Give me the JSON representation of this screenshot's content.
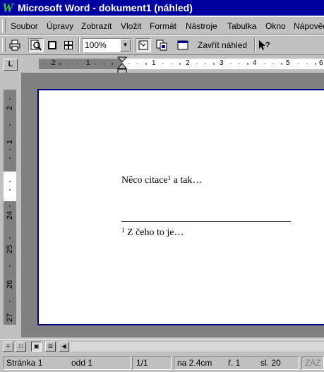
{
  "window": {
    "title": "Microsoft Word - dokument1 (náhled)",
    "logo": "W"
  },
  "menu": {
    "items": [
      {
        "label": "Soubor"
      },
      {
        "label": "Úpravy"
      },
      {
        "label": "Zobrazit"
      },
      {
        "label": "Vložit"
      },
      {
        "label": "Formát"
      },
      {
        "label": "Nástroje"
      },
      {
        "label": "Tabulka"
      },
      {
        "label": "Okno"
      },
      {
        "label": "Nápověda"
      }
    ]
  },
  "toolbar": {
    "icons": [
      "print-icon",
      "magnifier-icon",
      "one-page-icon",
      "multiple-pages-icon",
      "full-screen-icon",
      "shrink-to-fit-icon",
      "help-icon"
    ],
    "zoom_value": "100%",
    "close_preview_label": "Zavřít náhled"
  },
  "ruler": {
    "corner_label": "L",
    "h_labels": [
      "2",
      "1",
      "1",
      "2",
      "3",
      "4",
      "5",
      "6"
    ],
    "v_labels": [
      "2",
      "1",
      "24",
      "25",
      "26",
      "27"
    ]
  },
  "document": {
    "body_text_before": "Něco citace",
    "body_footnote_ref": "1",
    "body_text_after": " a tak…",
    "footnote_number": "1",
    "footnote_text": " Z čeho to je…"
  },
  "statusbar": {
    "page": "Stránka 1",
    "section": "odd 1",
    "page_of": "1/1",
    "at": "na 2.4cm",
    "line": "ř. 1",
    "column": "sl. 20",
    "rec": "ZÁZ"
  },
  "colors": {
    "titlebar": "#0000a0",
    "page_border": "#000080",
    "workspace": "#808080",
    "chrome": "#c0c0c0"
  }
}
